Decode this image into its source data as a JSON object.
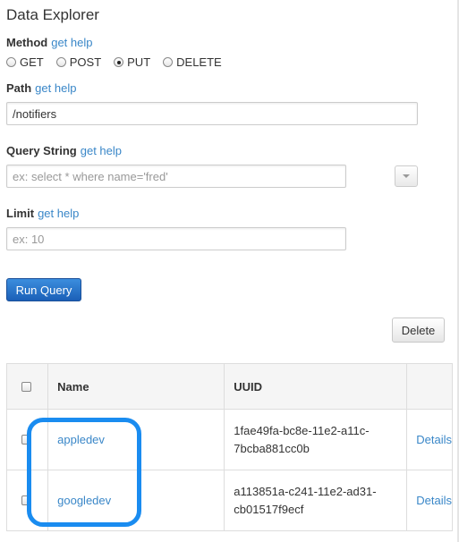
{
  "title": "Data Explorer",
  "method": {
    "label": "Method",
    "help": "get help",
    "options": [
      "GET",
      "POST",
      "PUT",
      "DELETE"
    ],
    "selected": "PUT"
  },
  "path": {
    "label": "Path",
    "help": "get help",
    "value": "/notifiers"
  },
  "query_string": {
    "label": "Query String",
    "help": "get help",
    "placeholder": "ex: select * where name='fred'"
  },
  "limit": {
    "label": "Limit",
    "help": "get help",
    "placeholder": "ex: 10"
  },
  "run_button": "Run Query",
  "delete_button": "Delete",
  "table": {
    "headers": {
      "name": "Name",
      "uuid": "UUID"
    },
    "rows": [
      {
        "name": "appledev",
        "uuid_line1": "1fae49fa-bc8e-11e2-a11c-",
        "uuid_line2": "7bcba881cc0b",
        "action": "Details"
      },
      {
        "name": "googledev",
        "uuid_line1": "a113851a-c241-11e2-ad31-",
        "uuid_line2": "cb01517f9ecf",
        "action": "Details"
      }
    ]
  },
  "colors": {
    "link": "#3a87c8",
    "primary_button": "#1b5fb7",
    "highlight": "#1a8cf0"
  }
}
